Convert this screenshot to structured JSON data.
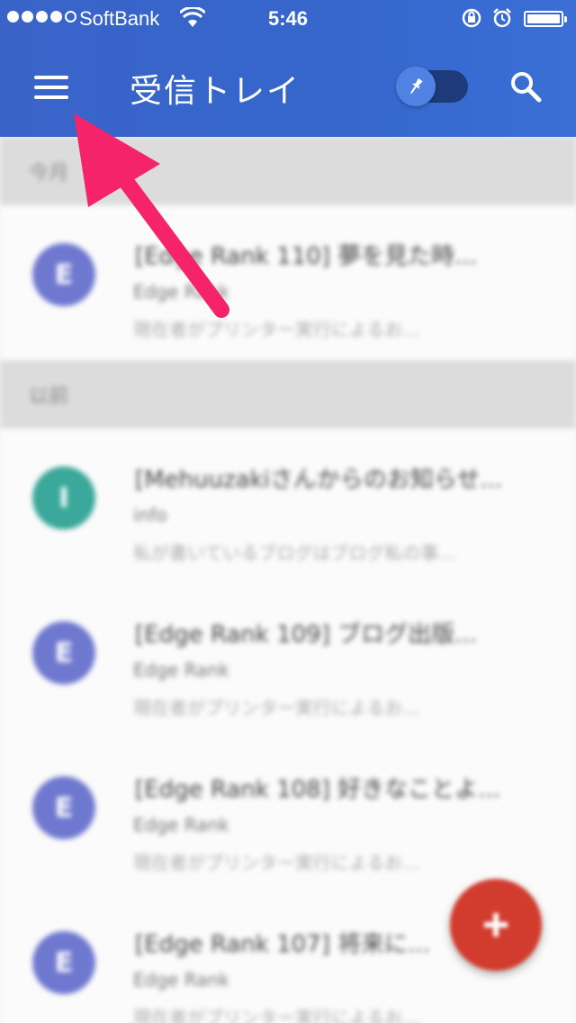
{
  "status_bar": {
    "carrier": "SoftBank",
    "time": "5:46",
    "signal_bars": 4,
    "icons": [
      "wifi-icon",
      "rotation-lock-icon",
      "alarm-icon",
      "battery-icon"
    ]
  },
  "app_bar": {
    "title": "受信トレイ",
    "menu_icon": "hamburger-menu-icon",
    "toggle_icon": "pin-icon",
    "search_icon": "search-icon"
  },
  "sections": [
    {
      "label": "今月",
      "items": [
        {
          "initial": "E",
          "avatar_color": "#6e78cf",
          "subject": "[Edge Rank 110] 夢を見た時...",
          "sender": "Edge Rank",
          "snippet": "現在者がプリンター実行によるお..."
        }
      ]
    },
    {
      "label": "以前",
      "items": [
        {
          "initial": "I",
          "avatar_color": "#3aa89a",
          "subject": "[Mehuuzakiさんからのお知らせ...",
          "sender": "info",
          "snippet": "私が書いているブログはブログ私の事..."
        },
        {
          "initial": "E",
          "avatar_color": "#6e78cf",
          "subject": "[Edge Rank 109] ブログ出版...",
          "sender": "Edge Rank",
          "snippet": "現在者がプリンター実行によるお..."
        },
        {
          "initial": "E",
          "avatar_color": "#6e78cf",
          "subject": "[Edge Rank 108] 好きなことよ...",
          "sender": "Edge Rank",
          "snippet": "現在者がプリンター実行によるお..."
        },
        {
          "initial": "E",
          "avatar_color": "#6e78cf",
          "subject": "[Edge Rank 107] 将来に...",
          "sender": "Edge Rank",
          "snippet": "現在者がプリンター実行によるお..."
        }
      ]
    }
  ],
  "fab": {
    "icon": "plus-icon",
    "color": "#d23c2e"
  },
  "annotation": {
    "icon": "arrow-pointer-icon",
    "color": "#f5246a"
  },
  "colors": {
    "app_bar": "#3567cc",
    "toggle_track": "#1f3a7a",
    "toggle_knob": "#4f82e3"
  }
}
